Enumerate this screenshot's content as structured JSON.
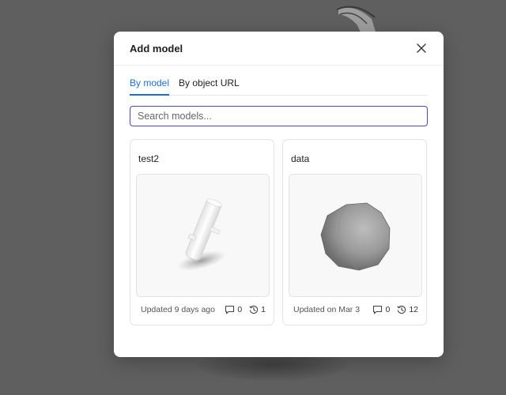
{
  "modal": {
    "title": "Add model",
    "tabs": [
      {
        "label": "By model",
        "active": true
      },
      {
        "label": "By object URL",
        "active": false
      }
    ],
    "search": {
      "placeholder": "Search models...",
      "value": ""
    }
  },
  "models": [
    {
      "name": "test2",
      "updated": "Updated 9 days ago",
      "comments": "0",
      "versions": "1"
    },
    {
      "name": "data",
      "updated": "Updated on Mar 3",
      "comments": "0",
      "versions": "12"
    }
  ],
  "colors": {
    "accent": "#1f6fd1",
    "search_border": "#4f47c9",
    "backdrop": "#5f5f5f"
  },
  "icons": [
    "close-icon",
    "comment-icon",
    "history-icon"
  ]
}
